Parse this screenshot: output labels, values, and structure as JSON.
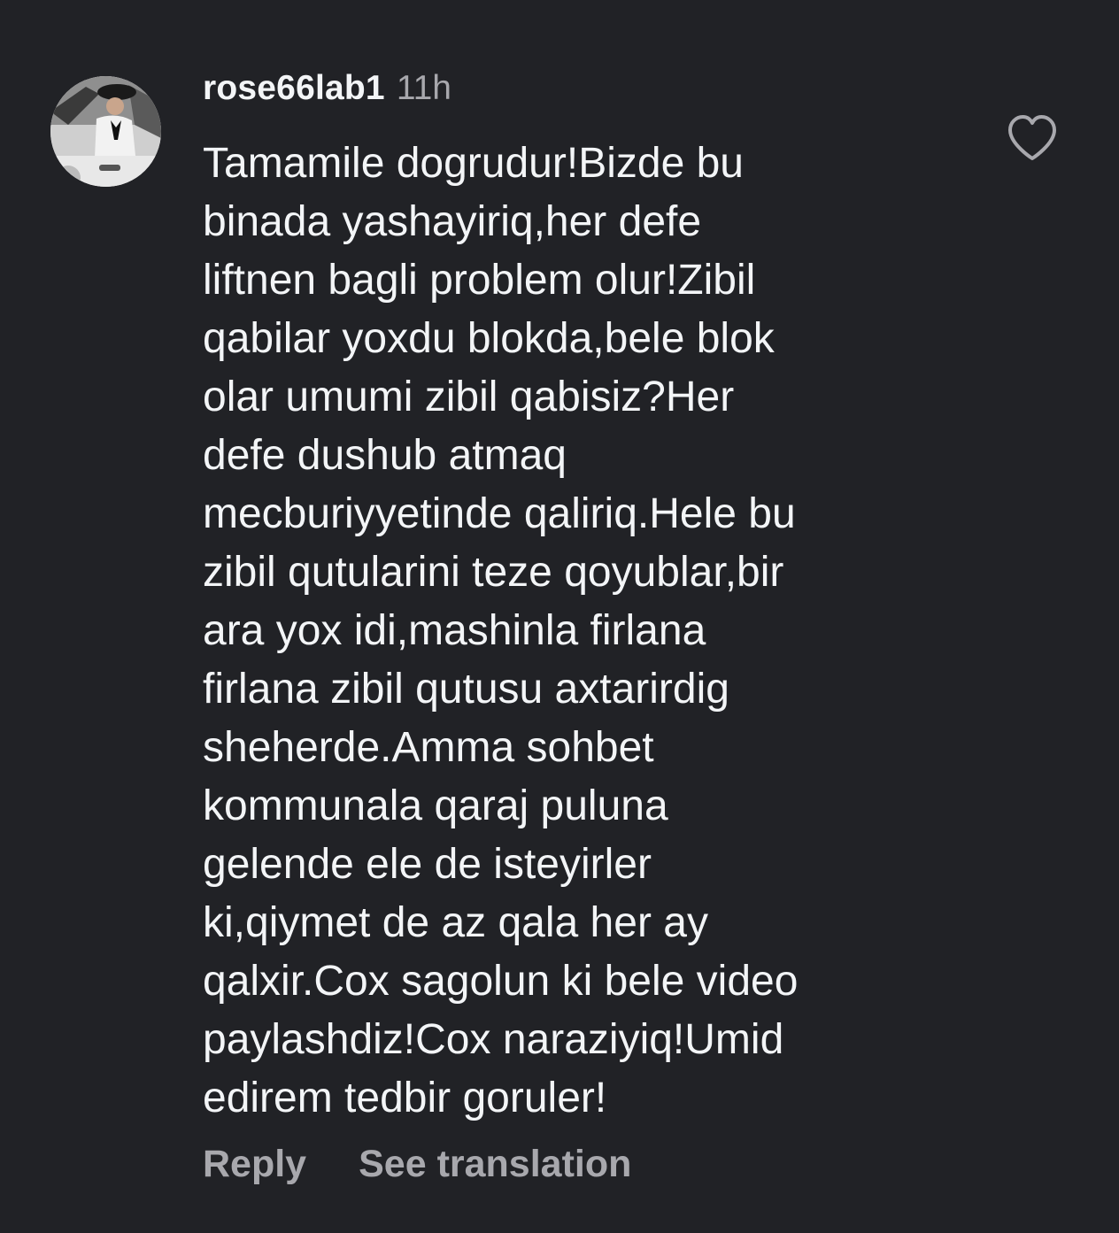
{
  "comment": {
    "username": "rose66lab1",
    "timestamp": "11h",
    "avatar_icon": "profile-photo",
    "text_lines": [
      "Tamamile dogrudur!Bizde bu",
      "binada yashayiriq,her defe",
      "liftnen bagli problem olur!Zibil",
      "qabilar yoxdu blokda,bele blok",
      "olar umumi zibil qabisiz?Her",
      "defe dushub atmaq",
      "mecburiyyetinde qaliriq.Hele bu",
      "zibil qutularini teze qoyublar,bir",
      "ara yox idi,mashinla firlana",
      "firlana zibil qutusu axtarirdig",
      "sheherde.Amma sohbet",
      "kommunala qaraj puluna",
      "gelende ele de isteyirler",
      "ki,qiymet de az qala her ay",
      "qalxir.Cox sagolun ki bele video",
      "paylashdiz!Cox naraziyiq!Umid",
      "edirem tedbir goruler!"
    ],
    "like_icon": "heart-outline-icon",
    "actions": {
      "reply_label": "Reply",
      "translate_label": "See translation"
    }
  },
  "colors": {
    "background": "#212226",
    "primary_text": "#f3f5f7",
    "secondary_text": "#a8a8ad"
  }
}
